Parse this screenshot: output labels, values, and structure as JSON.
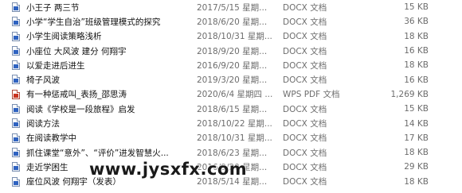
{
  "files": [
    {
      "name": "小王子 两三节",
      "date": "2017/5/15 星期...",
      "type": "DOCX 文档",
      "size": "15 KB",
      "icon": "docx-file-icon"
    },
    {
      "name": "小学“学生自治”班级管理模式的探究",
      "date": "2018/6/20 星期...",
      "type": "DOCX 文档",
      "size": "36 KB",
      "icon": "docx-file-icon"
    },
    {
      "name": "小学生阅读策略浅析",
      "date": "2018/10/31 星期...",
      "type": "DOCX 文档",
      "size": "18 KB",
      "icon": "docx-file-icon"
    },
    {
      "name": "小座位 大风波 建分 何翔宇",
      "date": "2018/9/20 星期...",
      "type": "DOCX 文档",
      "size": "16 KB",
      "icon": "docx-file-icon"
    },
    {
      "name": "以爱走进后进生",
      "date": "2016/9/20 星期...",
      "type": "DOCX 文档",
      "size": "18 KB",
      "icon": "docx-file-icon"
    },
    {
      "name": "椅子风波",
      "date": "2019/3/20 星期...",
      "type": "DOCX 文档",
      "size": "16 KB",
      "icon": "docx-file-icon"
    },
    {
      "name": "有一种惩戒叫_表扬_邵思涛",
      "date": "2020/6/4 星期四 ...",
      "type": "WPS PDF 文档",
      "size": "1,269 KB",
      "icon": "pdf-file-icon"
    },
    {
      "name": "阅读《学校是一段旅程》启发",
      "date": "2018/6/15 星期...",
      "type": "DOCX 文档",
      "size": "15 KB",
      "icon": "docx-file-icon"
    },
    {
      "name": "阅读方法",
      "date": "2018/10/22 星期...",
      "type": "DOCX 文档",
      "size": "14 KB",
      "icon": "docx-file-icon"
    },
    {
      "name": "在阅读教学中",
      "date": "2018/10/31 星期...",
      "type": "DOCX 文档",
      "size": "17 KB",
      "icon": "docx-file-icon"
    },
    {
      "name": "抓住课堂“意外”、“评价”进发智慧火...",
      "date": "2018/6/23 星期...",
      "type": "DOCX 文档",
      "size": "18 KB",
      "icon": "docx-file-icon"
    },
    {
      "name": "走近学困生",
      "date": "2016/9/20 星期...",
      "type": "DOCX 文档",
      "size": "29 KB",
      "icon": "docx-file-icon"
    },
    {
      "name": "座位风波 何翔宇（发表）",
      "date": "2018/5/14 星期...",
      "type": "DOCX 文档",
      "size": "18 KB",
      "icon": "docx-file-icon"
    }
  ],
  "watermark": "www.jysxfx.com",
  "colors": {
    "docx_icon": "#2f63c1",
    "pdf_icon": "#c8321f",
    "meta_text": "#6d6d6d"
  }
}
